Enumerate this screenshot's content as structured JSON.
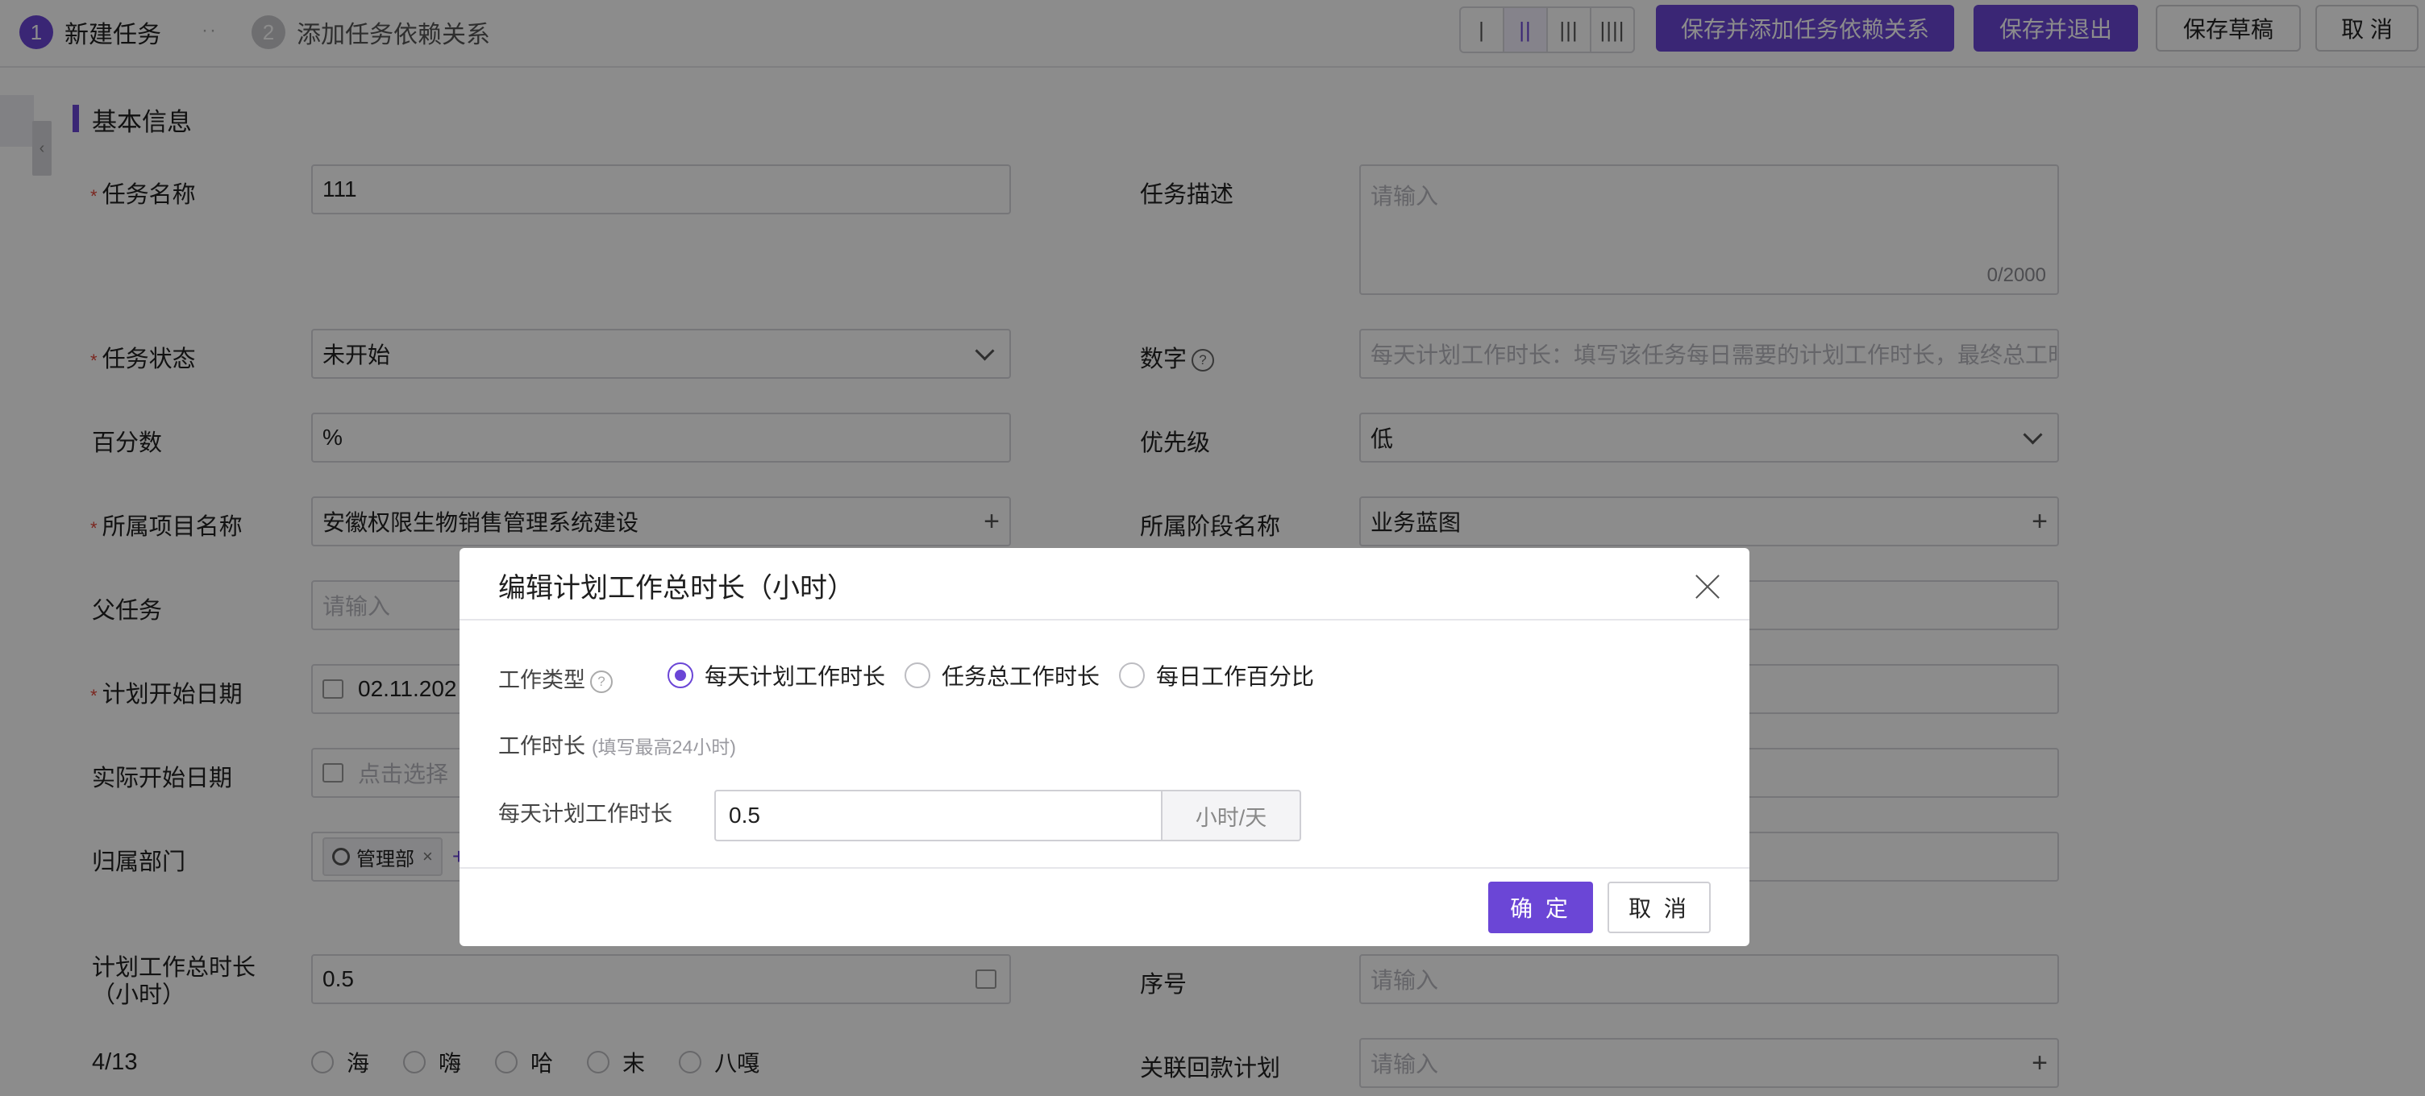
{
  "header": {
    "steps": [
      {
        "num": "1",
        "label": "新建任务"
      },
      {
        "num": "2",
        "label": "添加任务依赖关系"
      }
    ],
    "step_separator": "··",
    "column_options": [
      "|",
      "||",
      "|||",
      "||||"
    ],
    "buttons": {
      "save_add_dependency": "保存并添加任务依赖关系",
      "save_exit": "保存并退出",
      "save_draft": "保存草稿",
      "cancel": "取 消"
    }
  },
  "form": {
    "section_title": "基本信息",
    "task_name": {
      "label": "任务名称",
      "value": "111"
    },
    "task_desc": {
      "label": "任务描述",
      "placeholder": "请输入",
      "counter": "0/2000"
    },
    "task_status": {
      "label": "任务状态",
      "value": "未开始"
    },
    "number": {
      "label": "数字",
      "placeholder": "每天计划工作时长：填写该任务每日需要的计划工作时长，最终总工时"
    },
    "percent": {
      "label": "百分数",
      "value": "%"
    },
    "priority": {
      "label": "优先级",
      "value": "低"
    },
    "project_name": {
      "label": "所属项目名称",
      "value": "安徽权限生物销售管理系统建设"
    },
    "stage_name": {
      "label": "所属阶段名称",
      "value": "业务蓝图"
    },
    "parent_task": {
      "label": "父任务",
      "placeholder": "请输入"
    },
    "plan_start": {
      "label": "计划开始日期",
      "value": "02.11.202"
    },
    "actual_start": {
      "label": "实际开始日期",
      "placeholder": "点击选择"
    },
    "department": {
      "label": "归属部门",
      "tag": "管理部",
      "tag_close": "×",
      "add": "+"
    },
    "plan_total_hours": {
      "label": "计划工作总时长（小时）",
      "value": "0.5"
    },
    "serial": {
      "label": "序号",
      "placeholder": "请输入"
    },
    "options_413": {
      "label": "4/13",
      "options": [
        "海",
        "嗨",
        "哈",
        "末",
        "八嘎"
      ]
    },
    "linked_payment": {
      "label": "关联回款计划",
      "placeholder": "请输入"
    }
  },
  "modal": {
    "title": "编辑计划工作总时长（小时）",
    "work_type_label": "工作类型",
    "help_glyph": "?",
    "work_types": [
      "每天计划工作时长",
      "任务总工作时长",
      "每日工作百分比"
    ],
    "selected_work_type": "每天计划工作时长",
    "duration_label": "工作时长",
    "duration_hint": "(填写最高24小时)",
    "daily_hours_label": "每天计划工作时长",
    "daily_hours_value": "0.5",
    "daily_hours_unit": "小时/天",
    "ok": "确 定",
    "cancel": "取 消"
  },
  "colors": {
    "accent": "#6b46d6",
    "required": "#e0453a",
    "overlay": "rgba(0,0,0,0.45)"
  }
}
